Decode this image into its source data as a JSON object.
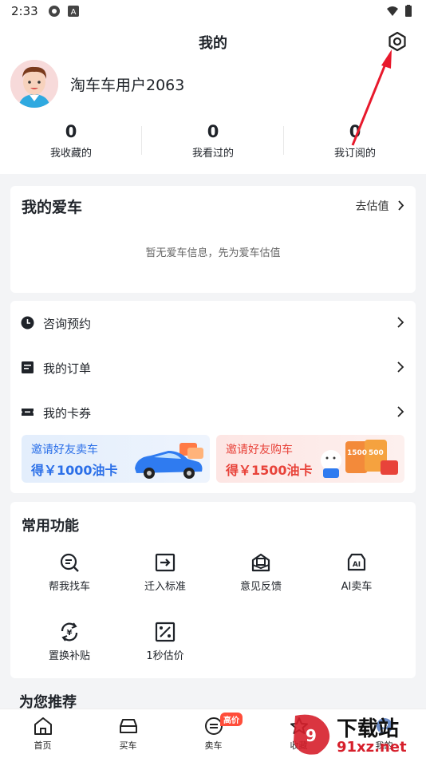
{
  "status_bar": {
    "time": "2:33"
  },
  "header": {
    "title": "我的"
  },
  "user": {
    "name": "淘车车用户2063"
  },
  "stats": [
    {
      "value": "0",
      "label": "我收藏的"
    },
    {
      "value": "0",
      "label": "我看过的"
    },
    {
      "value": "0",
      "label": "我订阅的"
    }
  ],
  "my_car": {
    "title": "我的爱车",
    "action": "去估值",
    "empty_tip": "暂无爱车信息，先为爱车估值"
  },
  "menu": {
    "items": [
      {
        "label": "咨询预约",
        "icon": "clock-icon"
      },
      {
        "label": "我的订单",
        "icon": "order-icon"
      },
      {
        "label": "我的卡券",
        "icon": "ticket-icon"
      }
    ]
  },
  "banners": [
    {
      "line1": "邀请好友卖车",
      "line2": "得￥1000油卡"
    },
    {
      "line1": "邀请好友购车",
      "line2": "得￥1500油卡",
      "coupon_a": "1500",
      "coupon_b": "500"
    }
  ],
  "features": {
    "title": "常用功能",
    "items": [
      {
        "label": "帮我找车",
        "icon": "search-car-icon"
      },
      {
        "label": "迁入标准",
        "icon": "move-in-icon"
      },
      {
        "label": "意见反馈",
        "icon": "feedback-icon"
      },
      {
        "label": "AI卖车",
        "icon": "ai-sell-icon"
      },
      {
        "label": "置换补贴",
        "icon": "exchange-icon"
      },
      {
        "label": "1秒估价",
        "icon": "estimate-icon"
      }
    ]
  },
  "recommend": {
    "title": "为您推荐"
  },
  "bottom_nav": {
    "items": [
      {
        "label": "首页",
        "icon": "home-icon"
      },
      {
        "label": "买车",
        "icon": "buy-car-icon"
      },
      {
        "label": "卖车",
        "icon": "sell-car-icon",
        "badge": "高价"
      },
      {
        "label": "收藏",
        "icon": "star-icon"
      },
      {
        "label": "我的",
        "icon": "profile-icon"
      }
    ]
  },
  "watermark": {
    "text_a": "下载站",
    "text_b": "91xz.net"
  },
  "colors": {
    "accent_blue": "#2b6fe8",
    "accent_red": "#e8433a",
    "annotation_red": "#e8192c"
  }
}
